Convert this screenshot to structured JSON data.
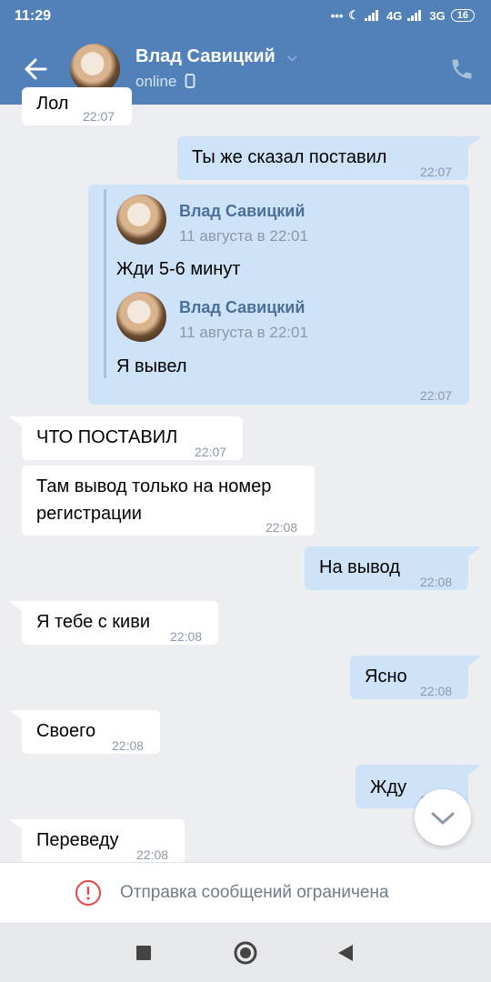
{
  "status_bar": {
    "time": "11:29",
    "network_1": "4G",
    "network_2": "3G",
    "battery": "16"
  },
  "header": {
    "contact_name": "Влад Савицкий",
    "status": "online"
  },
  "messages": [
    {
      "dir": "in",
      "text": "Лол",
      "time": "22:07"
    },
    {
      "dir": "out",
      "text": "Ты же сказал поставил",
      "time": "22:07"
    },
    {
      "dir": "out",
      "time": "22:07",
      "forwarded": [
        {
          "name": "Влад Савицкий",
          "date": "11 августа в 22:01",
          "text": "Жди 5-6 минут"
        },
        {
          "name": "Влад Савицкий",
          "date": "11 августа в 22:01",
          "text": "Я вывел"
        }
      ]
    },
    {
      "dir": "in",
      "text": "ЧТО ПОСТАВИЛ",
      "time": "22:07"
    },
    {
      "dir": "in",
      "text_line1": "Там вывод только на номер",
      "text_line2": "регистрации",
      "time": "22:08"
    },
    {
      "dir": "out",
      "text": "На вывод",
      "time": "22:08"
    },
    {
      "dir": "in",
      "text": "Я тебе с киви",
      "time": "22:08"
    },
    {
      "dir": "out",
      "text": "Ясно",
      "time": "22:08"
    },
    {
      "dir": "in",
      "text": "Своего",
      "time": "22:08"
    },
    {
      "dir": "out",
      "text": "Жду",
      "time": "22:08"
    },
    {
      "dir": "in",
      "text": "Переведу",
      "time": "22:08"
    }
  ],
  "restriction_notice": "Отправка сообщений ограничена",
  "colors": {
    "header": "#5181b8",
    "chat_background": "#edeef0",
    "outgoing_bubble": "#cfe3f8",
    "incoming_bubble": "#ffffff",
    "warning": "#e64646"
  },
  "icons": [
    "back-arrow-icon",
    "phone-icon",
    "phone-device-icon",
    "chevron-down-icon",
    "warning-icon",
    "square-nav-icon",
    "circle-nav-icon",
    "triangle-nav-icon"
  ]
}
